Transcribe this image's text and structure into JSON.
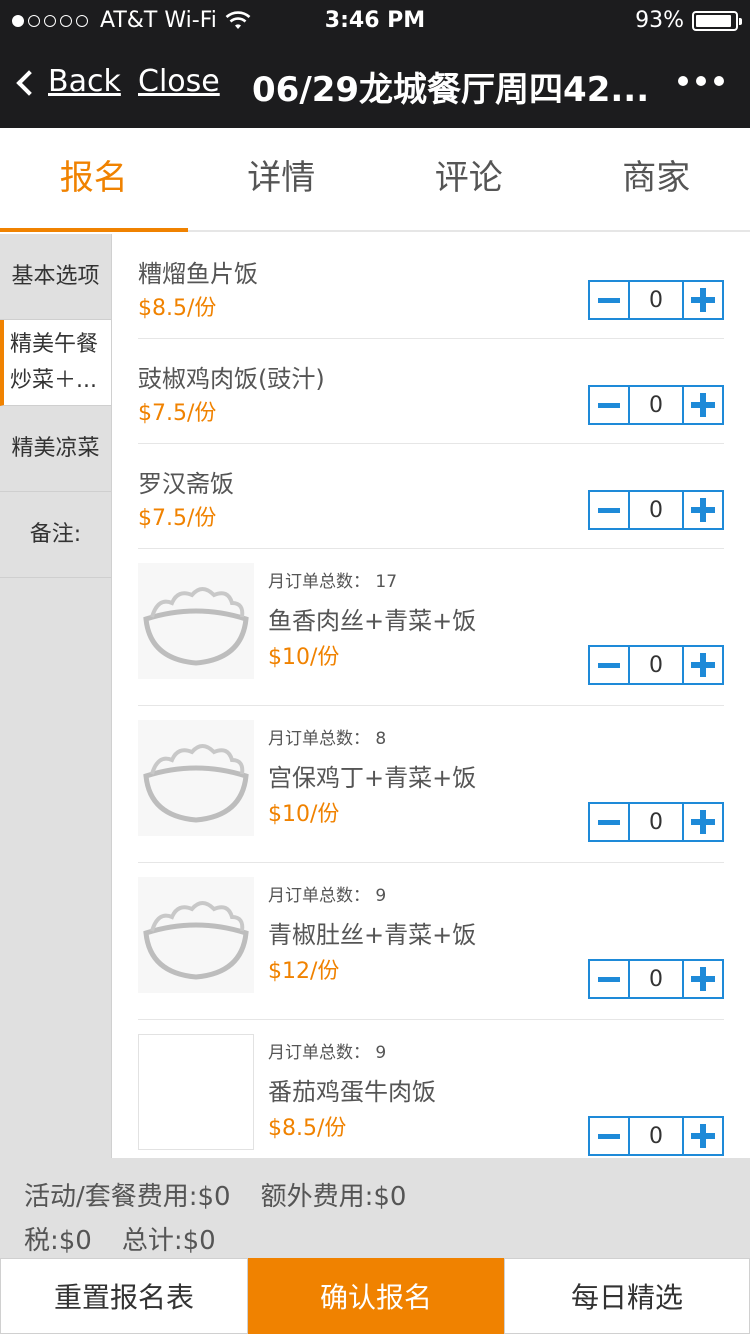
{
  "status": {
    "carrier": "AT&T Wi-Fi",
    "time": "3:46 PM",
    "battery": "93%",
    "battery_level_percent": 93,
    "signal_dots_filled": 1,
    "signal_dots_total": 5
  },
  "navbar": {
    "back": "Back",
    "close": "Close",
    "title": "06/29龙城餐厅周四42..."
  },
  "tabs": [
    {
      "label": "报名"
    },
    {
      "label": "详情"
    },
    {
      "label": "评论"
    },
    {
      "label": "商家"
    }
  ],
  "sidebar": [
    {
      "label": "基本选项"
    },
    {
      "label": "精美午餐炒菜＋..."
    },
    {
      "label": "精美凉菜"
    },
    {
      "label": "备注:"
    }
  ],
  "items": [
    {
      "name": "糟熘鱼片饭",
      "price": "$8.5/份",
      "qty": "0"
    },
    {
      "name": "豉椒鸡肉饭(豉汁)",
      "price": "$7.5/份",
      "qty": "0"
    },
    {
      "name": "罗汉斋饭",
      "price": "$7.5/份",
      "qty": "0"
    },
    {
      "monthly": "月订单总数： 17",
      "name": "鱼香肉丝+青菜+饭",
      "price": "$10/份",
      "qty": "0"
    },
    {
      "monthly": "月订单总数： 8",
      "name": "宫保鸡丁+青菜+饭",
      "price": "$10/份",
      "qty": "0"
    },
    {
      "monthly": "月订单总数： 9",
      "name": "青椒肚丝+青菜+饭",
      "price": "$12/份",
      "qty": "0"
    },
    {
      "monthly": "月订单总数： 9",
      "name": "番茄鸡蛋牛肉饭",
      "price": "$8.5/份",
      "qty": "0"
    }
  ],
  "summary": {
    "activity_fee": "活动/套餐费用:$0",
    "extra_fee": "额外费用:$0",
    "tax": "税:$0",
    "total": "总计:$0"
  },
  "bottom": {
    "reset": "重置报名表",
    "confirm": "确认报名",
    "daily": "每日精选"
  },
  "colors": {
    "accent": "#f08200",
    "stepper": "#1e8ad8",
    "bar": "#1c1c1e"
  }
}
